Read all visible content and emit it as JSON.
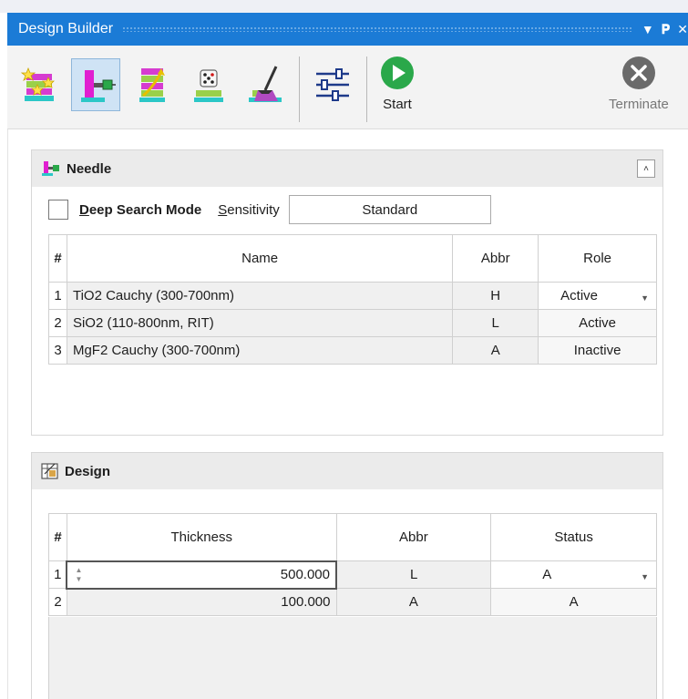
{
  "window": {
    "title": "Design Builder",
    "controls": [
      {
        "name": "dropdown",
        "glyph": "▼"
      },
      {
        "name": "pin",
        "glyph": "ᛘ"
      },
      {
        "name": "close",
        "glyph": "✕"
      }
    ]
  },
  "toolbar": {
    "tools": [
      {
        "name": "synthesis-tool",
        "icon": "stars-stack-icon"
      },
      {
        "name": "needle-tool",
        "icon": "needle-icon",
        "selected": true
      },
      {
        "name": "gradual-evolution-tool",
        "icon": "stack-arrow-icon"
      },
      {
        "name": "random-tool",
        "icon": "dice-stack-icon"
      },
      {
        "name": "cleanup-tool",
        "icon": "broom-icon"
      },
      {
        "name": "settings-tool",
        "icon": "sliders-icon"
      }
    ],
    "start_label": "Start",
    "terminate_label": "Terminate"
  },
  "needle": {
    "title": "Needle",
    "deep_search": {
      "label": "Deep Search Mode",
      "checked": false
    },
    "sensitivity": {
      "label": "Sensitivity",
      "value": "Standard"
    },
    "columns": {
      "hash": "#",
      "name": "Name",
      "abbr": "Abbr",
      "role": "Role"
    },
    "rows": [
      {
        "idx": "1",
        "name": "TiO2 Cauchy (300-700nm)",
        "abbr": "H",
        "role": "Active"
      },
      {
        "idx": "2",
        "name": "SiO2 (110-800nm, RIT)",
        "abbr": "L",
        "role": "Active"
      },
      {
        "idx": "3",
        "name": "MgF2 Cauchy (300-700nm)",
        "abbr": "A",
        "role": "Inactive"
      }
    ]
  },
  "design": {
    "title": "Design",
    "columns": {
      "hash": "#",
      "thickness": "Thickness",
      "abbr": "Abbr",
      "status": "Status"
    },
    "rows": [
      {
        "idx": "1",
        "thickness": "500.000",
        "abbr": "L",
        "status": "A"
      },
      {
        "idx": "2",
        "thickness": "100.000",
        "abbr": "A",
        "status": "A"
      }
    ]
  },
  "colors": {
    "titlebar": "#1b7bd6",
    "start_green": "#2aa84a",
    "terminate_gray": "#6a6a6a",
    "needle_magenta": "#e01fd0"
  }
}
